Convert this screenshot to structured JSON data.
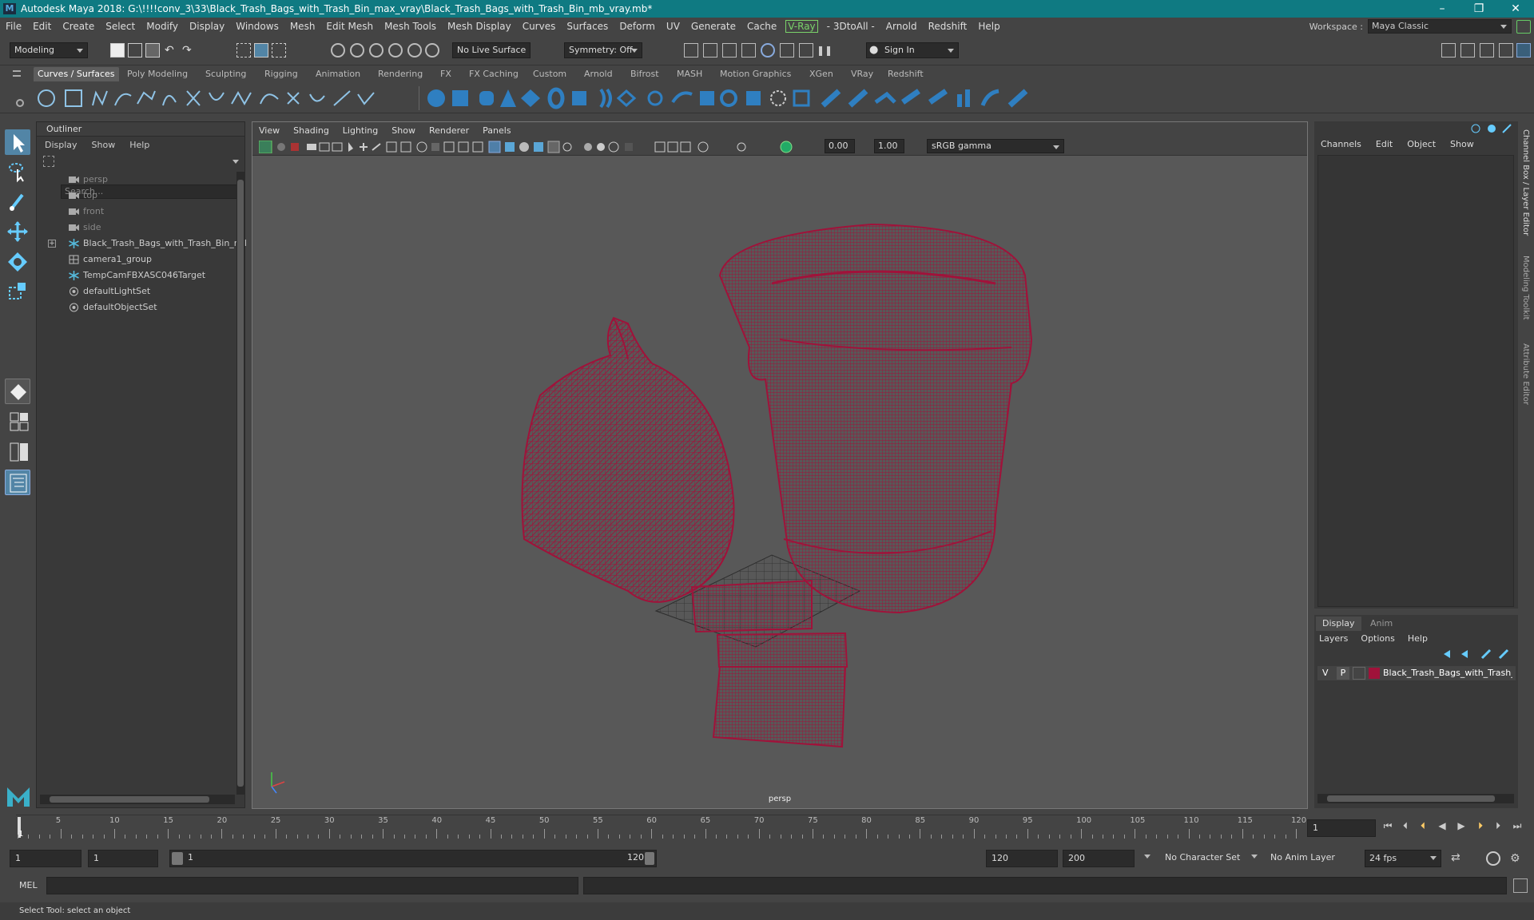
{
  "window": {
    "title": "Autodesk Maya 2018: G:\\!!!!conv_3\\33\\Black_Trash_Bags_with_Trash_Bin_max_vray\\Black_Trash_Bags_with_Trash_Bin_mb_vray.mb*",
    "icon_letter": "M"
  },
  "menubar": {
    "items": [
      "File",
      "Edit",
      "Create",
      "Select",
      "Modify",
      "Display",
      "Windows",
      "Mesh",
      "Edit Mesh",
      "Mesh Tools",
      "Mesh Display",
      "Curves",
      "Surfaces",
      "Deform",
      "UV",
      "Generate",
      "Cache"
    ],
    "vray": "V-Ray",
    "items2": [
      "- 3DtoAll -",
      "Arnold",
      "Redshift",
      "Help"
    ]
  },
  "workspace": {
    "label": "Workspace :",
    "value": "Maya Classic"
  },
  "status": {
    "mode": "Modeling",
    "live_surface": "No Live Surface",
    "symmetry": "Symmetry: Off",
    "sign_in": "Sign In"
  },
  "shelf": {
    "tabs": [
      "Curves / Surfaces",
      "Poly Modeling",
      "Sculpting",
      "Rigging",
      "Animation",
      "Rendering",
      "FX",
      "FX Caching",
      "Custom",
      "Arnold",
      "Bifrost",
      "MASH",
      "Motion Graphics",
      "XGen",
      "VRay",
      "Redshift"
    ],
    "active_tab": "Curves / Surfaces"
  },
  "outliner": {
    "title": "Outliner",
    "menu": [
      "Display",
      "Show",
      "Help"
    ],
    "search_placeholder": "Search...",
    "items": [
      {
        "label": "persp",
        "icon": "camera-icon",
        "dim": true
      },
      {
        "label": "top",
        "icon": "camera-icon",
        "dim": true
      },
      {
        "label": "front",
        "icon": "camera-icon",
        "dim": true
      },
      {
        "label": "side",
        "icon": "camera-icon",
        "dim": true
      },
      {
        "label": "Black_Trash_Bags_with_Trash_Bin_ncl",
        "icon": "transform-icon",
        "dim": false,
        "expandable": true
      },
      {
        "label": "camera1_group",
        "icon": "group-icon",
        "dim": false
      },
      {
        "label": "TempCamFBXASC046Target",
        "icon": "transform-icon",
        "dim": false
      },
      {
        "label": "defaultLightSet",
        "icon": "set-icon",
        "dim": false
      },
      {
        "label": "defaultObjectSet",
        "icon": "set-icon",
        "dim": false
      }
    ]
  },
  "viewport": {
    "menu": [
      "View",
      "Shading",
      "Lighting",
      "Show",
      "Renderer",
      "Panels"
    ],
    "exposure": "0.00",
    "gamma": "1.00",
    "color_space": "sRGB gamma",
    "camera_label": "persp",
    "wire_color": "#a0123a",
    "grid_color": "#2e2e2e"
  },
  "channelbox": {
    "menu": [
      "Channels",
      "Edit",
      "Object",
      "Show"
    ],
    "side_tabs": [
      "Channel Box / Layer Editor",
      "Modeling Toolkit",
      "Attribute Editor"
    ]
  },
  "layers": {
    "tabs": [
      "Display",
      "Anim"
    ],
    "active_tab": "Display",
    "menu": [
      "Layers",
      "Options",
      "Help"
    ],
    "row": {
      "v": "V",
      "p": "P",
      "name": "Black_Trash_Bags_with_Trash_B",
      "color": "#a0123a"
    }
  },
  "timeline": {
    "ticks": [
      5,
      10,
      15,
      20,
      25,
      30,
      35,
      40,
      45,
      50,
      55,
      60,
      65,
      70,
      75,
      80,
      85,
      90,
      95,
      100,
      105,
      110,
      115,
      120
    ],
    "current_frame_marker": "1",
    "current_frame": "1"
  },
  "range": {
    "start": "1",
    "playback_start": "1",
    "slider_start": "1",
    "slider_end": "120",
    "playback_end": "120",
    "end": "200",
    "character_set": "No Character Set",
    "anim_layer": "No Anim Layer",
    "fps": "24 fps"
  },
  "command": {
    "label": "MEL"
  },
  "help": {
    "text": "Select Tool: select an object"
  }
}
